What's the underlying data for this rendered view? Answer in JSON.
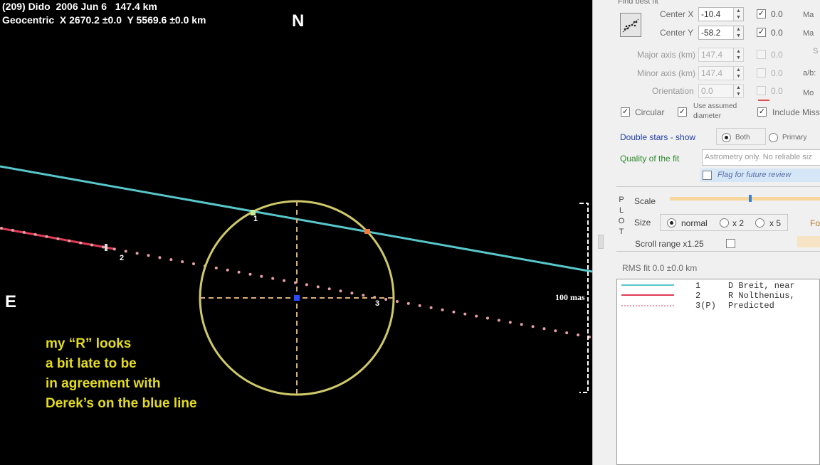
{
  "plot": {
    "header_line1": "(209) Dido  2006 Jun 6   147.4 km",
    "header_line2": "Geocentric  X 2670.2 ±0.0  Y 5569.6 ±0.0 km",
    "north_label": "N",
    "east_label": "E",
    "scale_label": "100 mas",
    "chord_labels": [
      "1",
      "2",
      "3"
    ],
    "annotation_lines": [
      "my “R” looks",
      "a bit late to be",
      "in agreement with",
      "Derek’s on the blue line"
    ],
    "colors": {
      "background": "#000000",
      "ellipse": "#cfc96a",
      "cross": "#d9b07a",
      "chord1": "#58c7cb",
      "chord2": "#e03a55",
      "predicted": "#e8a0a8",
      "center": "#2a4cff",
      "annotation": "#e3dc22"
    }
  },
  "panel": {
    "find_best_fit": "Find best fit",
    "fit_button_icon": "scatter-fit-icon",
    "center_x_label": "Center X",
    "center_x_value": "-10.4",
    "center_x_sigma": "0.0",
    "center_y_label": "Center Y",
    "center_y_value": "-58.2",
    "center_y_sigma": "0.0",
    "major_label": "Major axis (km)",
    "major_value": "147.4",
    "major_sigma": "0.0",
    "minor_label": "Minor axis (km)",
    "minor_value": "147.4",
    "minor_sigma": "0.0",
    "orient_label": "Orientation",
    "orient_value": "0.0",
    "orient_sigma": "0.0",
    "right_col_max1": "Ma",
    "right_col_max2": "Ma",
    "right_col_s": "S",
    "right_col_ab": "a/b:",
    "right_col_mo": "Mo",
    "circular_label": "Circular",
    "assumed_diam_label1": "Use assumed",
    "assumed_diam_label2": "diameter",
    "include_miss_label": "Include Miss",
    "double_stars_label": "Double stars - show",
    "both_label": "Both",
    "primary_label": "Primary",
    "quality_label": "Quality of the fit",
    "quality_value": "Astrometry only. No reliable siz",
    "flag_label": "Flag for future review",
    "plot_vertical": [
      "P",
      "L",
      "O",
      "T"
    ],
    "scale_label": "Scale",
    "size_label": "Size",
    "size_normal": "normal",
    "size_x2": "x 2",
    "size_x5": "x 5",
    "size_fo": "Fo",
    "scroll_range_label": "Scroll range x1.25",
    "rms_fit": "RMS fit 0.0 ±0.0 km",
    "legend": [
      {
        "num": "1",
        "text": "D Breit, near",
        "color": "#58c7cb",
        "style": "solid"
      },
      {
        "num": "2",
        "text": "R Nolthenius,",
        "color": "#e03a55",
        "style": "solid"
      },
      {
        "num": "3(P)",
        "text": "Predicted",
        "color": "#e8a0a8",
        "style": "dotted"
      }
    ]
  }
}
